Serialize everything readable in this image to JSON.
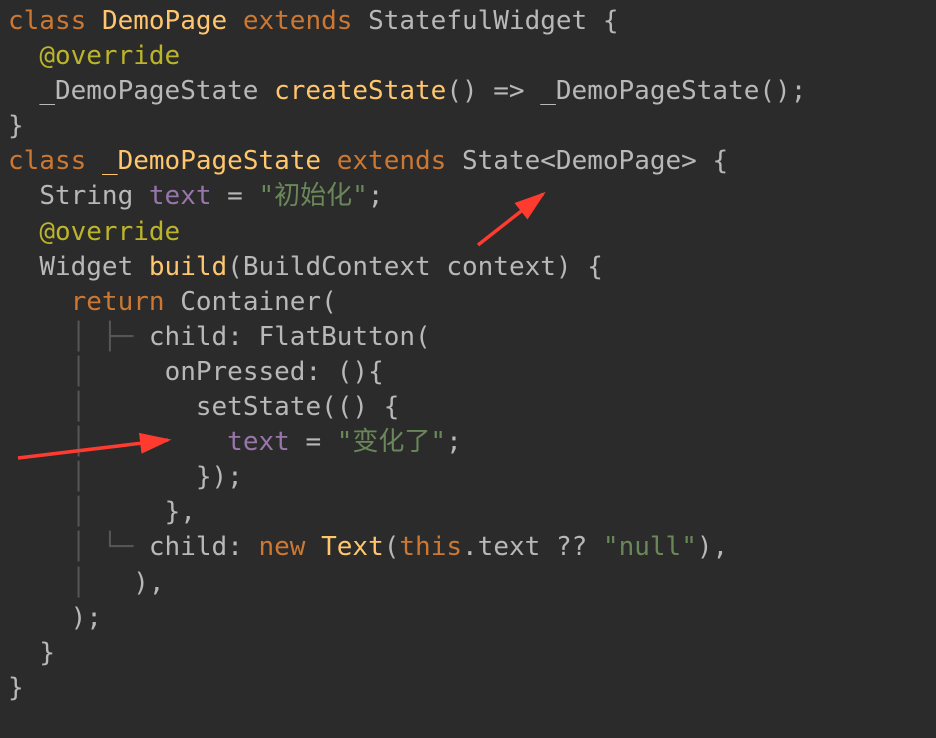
{
  "code": {
    "l1_kw1": "class",
    "l1_name": "DemoPage",
    "l1_kw2": "extends",
    "l1_sup": "StatefulWidget",
    "l1_brace": "{",
    "l2_ann": "@override",
    "l3_type": "_DemoPageState",
    "l3_method": "createState",
    "l3_mid": "() =>",
    "l3_call": "_DemoPageState",
    "l3_end": "();",
    "l4_close": "}",
    "l5_kw1": "class",
    "l5_name": "_DemoPageState",
    "l5_kw2": "extends",
    "l5_sup": "State",
    "l5_ang1": "<",
    "l5_param": "DemoPage",
    "l5_ang2": ">",
    "l5_brace": "{",
    "l6_type": "String",
    "l6_var": "text",
    "l6_eq": " = ",
    "l6_str": "\"初始化\"",
    "l6_semi": ";",
    "l7_ann": "@override",
    "l8_ret": "Widget",
    "l8_method": "build",
    "l8_p1": "(",
    "l8_ptype": "BuildContext",
    "l8_pname": " context",
    "l8_p2": ") {",
    "l9_kw": "return",
    "l9_call": "Container",
    "l9_paren": "(",
    "l10_guide": "├─",
    "l10_child": "child",
    "l10_colon": ": ",
    "l10_call": "FlatButton",
    "l10_paren": "(",
    "l11_label": "onPressed",
    "l11_rest": ": (){",
    "l12_call": "setState",
    "l12_rest": "(() {",
    "l13_var": "text",
    "l13_eq": " = ",
    "l13_str": "\"变化了\"",
    "l13_semi": ";",
    "l14": "});",
    "l15": "},",
    "l16_guide": "└─",
    "l16_child": "child",
    "l16_colon": ": ",
    "l16_new": "new",
    "l16_sp": " ",
    "l16_call": "Text",
    "l16_p1": "(",
    "l16_this": "this",
    "l16_dot": ".text ?? ",
    "l16_str": "\"null\"",
    "l16_p2": "),",
    "l17": "),",
    "l18": ");",
    "l19": "}",
    "l20": "}"
  }
}
